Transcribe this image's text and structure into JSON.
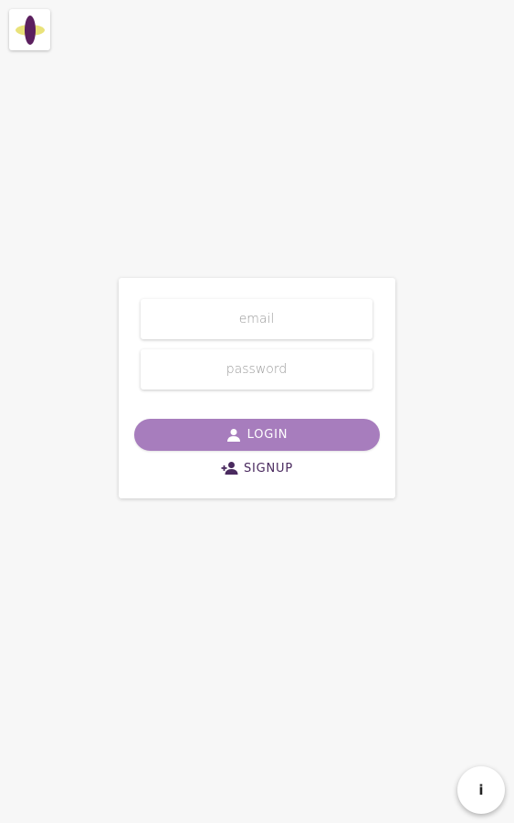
{
  "app": {
    "logo_icon": "clover-logo-icon",
    "colors": {
      "background": "#f7f7f7",
      "accent": "#a77dbd",
      "dark_purple": "#4a2a5f",
      "logo_purple": "#5b1f5e",
      "logo_yellow": "#e9e27a"
    }
  },
  "login_form": {
    "email_placeholder": "email",
    "email_value": "",
    "password_placeholder": "password",
    "password_value": "",
    "login_label": "LOGIN",
    "login_icon": "person-icon",
    "signup_label": "SIGNUP",
    "signup_icon": "person-add-icon"
  },
  "info_button": {
    "label": "i",
    "icon": "info-icon"
  }
}
